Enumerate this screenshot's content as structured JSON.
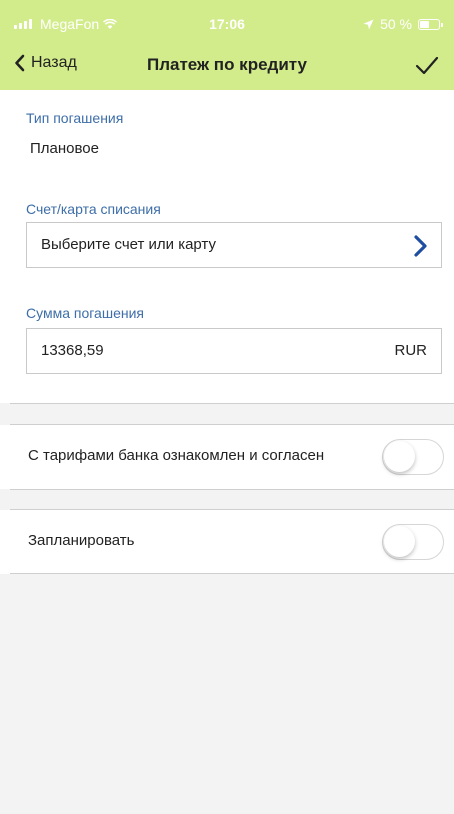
{
  "status_bar": {
    "carrier": "MegaFon",
    "time": "17:06",
    "battery": "50 %",
    "icons": [
      "signal-icon",
      "wifi-icon",
      "location-icon",
      "battery-icon"
    ]
  },
  "nav": {
    "back_label": "Назад",
    "title": "Платеж по кредиту",
    "confirm_icon": "checkmark-icon"
  },
  "repayment_type": {
    "label": "Тип погашения",
    "value": "Плановое"
  },
  "debit_account": {
    "label": "Счет/карта списания",
    "placeholder": "Выберите счет или карту",
    "icon": "chevron-right-icon"
  },
  "repayment_amount": {
    "label": "Сумма погашения",
    "value": "13368,59",
    "currency": "RUR"
  },
  "toggles": [
    {
      "label": "С тарифами банка ознакомлен и согласен",
      "on": false
    },
    {
      "label": "Запланировать",
      "on": false
    }
  ],
  "colors": {
    "header_bg": "#d3ec8b",
    "label_blue": "#3d6ea8",
    "chevron_blue": "#1f4ea1",
    "page_bg": "#f3f3f3"
  }
}
